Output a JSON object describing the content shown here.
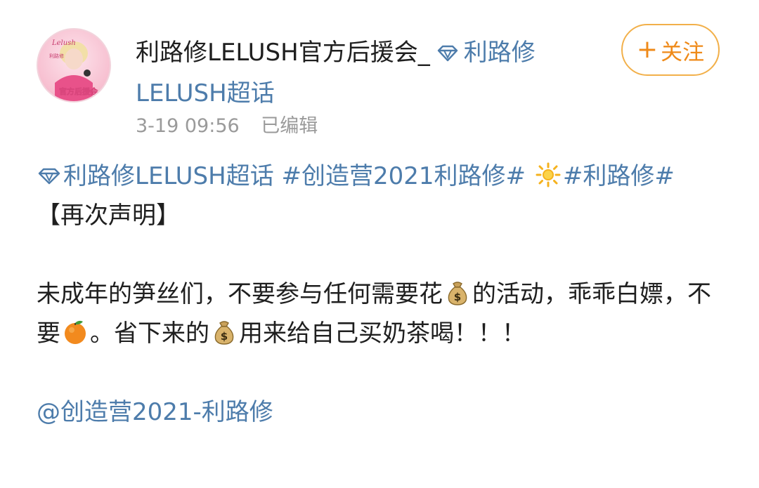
{
  "post": {
    "author": {
      "name": "利路修LELUSH官方后援会_",
      "avatar_text_top": "Lelush",
      "avatar_text_mid": "利路修",
      "avatar_text_bottom": "官方后援会"
    },
    "super_topic_label": "利路修LELUSH超话",
    "follow_button": "关注",
    "timestamp": "3-19 09:56",
    "edited_label": "已编辑",
    "tags": {
      "super_topic": "利路修LELUSH超话",
      "tag_1": "#创造营2021利路修#",
      "tag_2": "#利路修#"
    },
    "heading": "【再次声明】",
    "body_part_1": "未成年的笋丝们，不要参与任何需要花",
    "body_part_2": "的活动，乖乖白嫖，不要",
    "body_part_3": "。省下来的",
    "body_part_4": "用来给自己买奶茶喝！！！",
    "mention": "@创造营2021-利路修"
  },
  "icons": {
    "gem": "diamond-icon",
    "money_bag": "money-bag-icon",
    "orange": "tangerine-icon",
    "sun": "sun-icon"
  },
  "colors": {
    "link": "#4d7cab",
    "follow_accent": "#ef8a19",
    "meta_text": "#9a9a9a"
  }
}
